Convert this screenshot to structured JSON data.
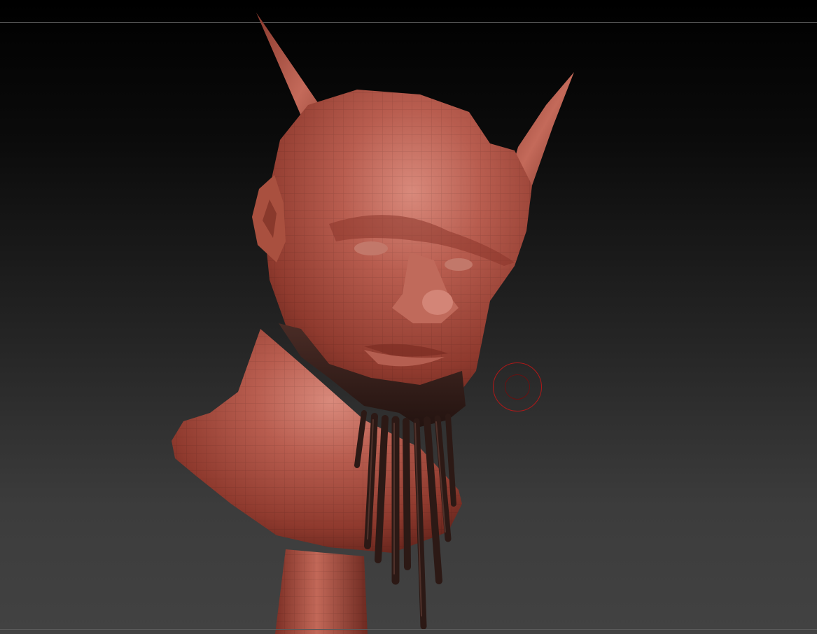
{
  "canvas": {
    "background_top": "#000000",
    "background_bottom": "#424242",
    "material_color": "#a4493c",
    "material_highlight": "#d98a7c",
    "beard_color": "#3a2420"
  },
  "model": {
    "icon": "sculpted-demon-head",
    "parts": [
      "head",
      "left-horn",
      "right-horn",
      "ear",
      "beard",
      "neck-base",
      "stand-post"
    ]
  },
  "brush": {
    "icon": "brush-cursor-circle",
    "color": "#b01818"
  }
}
